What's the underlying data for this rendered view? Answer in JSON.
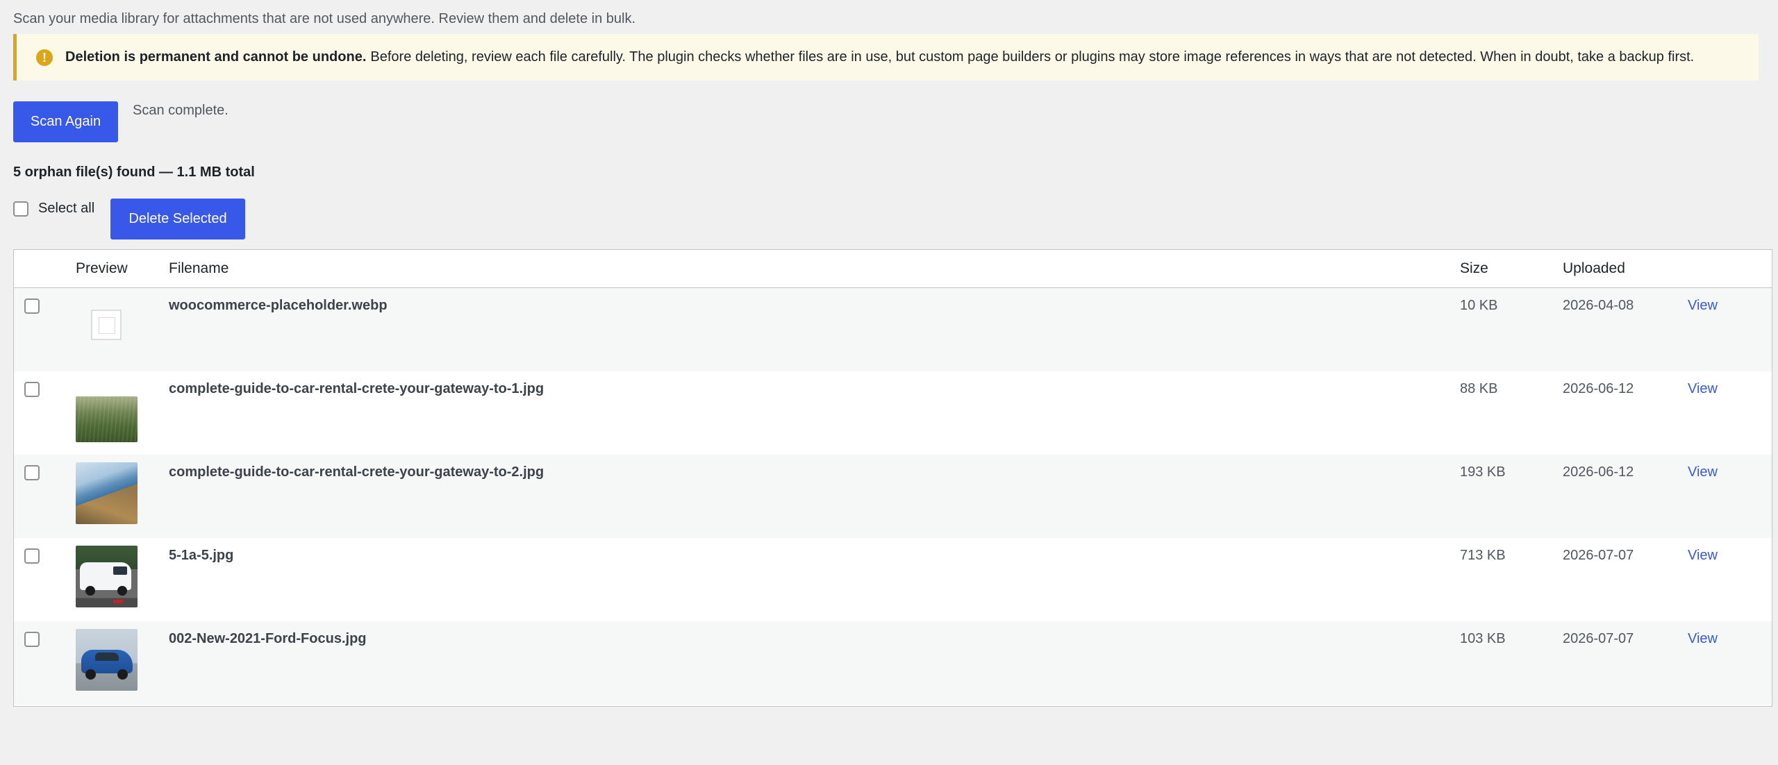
{
  "intro_text": "Scan your media library for attachments that are not used anywhere. Review them and delete in bulk.",
  "notice": {
    "icon": "warning-icon",
    "icon_glyph": "!",
    "bold": "Deletion is permanent and cannot be undone.",
    "text": "Before deleting, review each file carefully. The plugin checks whether files are in use, but custom page builders or plugins may store image references in ways that are not detected. When in doubt, take a backup first.",
    "border_color": "#dba617",
    "background": "#fcf9e8"
  },
  "scan": {
    "button_label": "Scan Again",
    "status": "Scan complete."
  },
  "summary": "5 orphan file(s) found — 1.1 MB total",
  "bulk": {
    "select_all_label": "Select all",
    "delete_label": "Delete Selected"
  },
  "accent_color": "#3858e9",
  "table": {
    "headers": {
      "preview": "Preview",
      "filename": "Filename",
      "size": "Size",
      "uploaded": "Uploaded"
    },
    "rows": [
      {
        "filename": "woocommerce-placeholder.webp",
        "size": "10 KB",
        "uploaded": "2026-04-08",
        "action": "View",
        "preview": "placeholder-icon"
      },
      {
        "filename": "complete-guide-to-car-rental-crete-your-gateway-to-1.jpg",
        "size": "88 KB",
        "uploaded": "2026-06-12",
        "action": "View",
        "preview": "grass-field-thumbnail"
      },
      {
        "filename": "complete-guide-to-car-rental-crete-your-gateway-to-2.jpg",
        "size": "193 KB",
        "uploaded": "2026-06-12",
        "action": "View",
        "preview": "coastline-thumbnail"
      },
      {
        "filename": "5-1a-5.jpg",
        "size": "713 KB",
        "uploaded": "2026-07-07",
        "action": "View",
        "preview": "white-van-thumbnail"
      },
      {
        "filename": "002-New-2021-Ford-Focus.jpg",
        "size": "103 KB",
        "uploaded": "2026-07-07",
        "action": "View",
        "preview": "blue-car-thumbnail"
      }
    ]
  }
}
